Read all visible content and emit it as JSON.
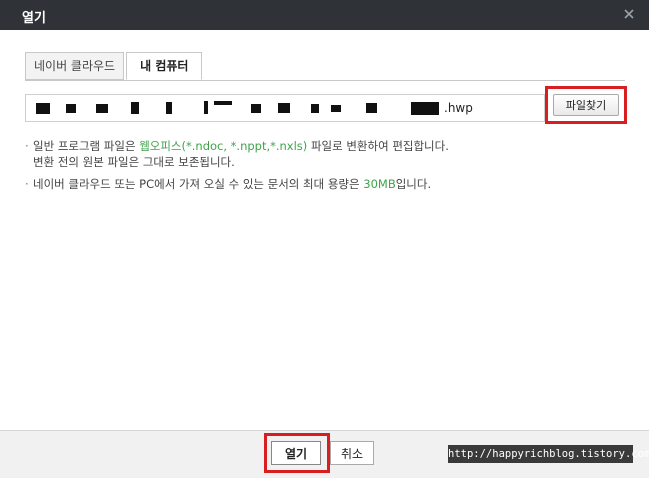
{
  "dialog": {
    "title": "열기",
    "close_icon": "close-icon"
  },
  "tabs": [
    {
      "label": "네이버 클라우드",
      "active": false
    },
    {
      "label": "내 컴퓨터",
      "active": true
    }
  ],
  "file": {
    "extension": ".hwp",
    "find_button_label": "파일찾기"
  },
  "info": {
    "line1_prefix": "일반 프로그램 파일은 ",
    "line1_highlight": "웹오피스(*.ndoc, *.nppt,*.nxls)",
    "line1_suffix": " 파일로 변환하여 편집합니다.",
    "line2": "변환 전의 원본 파일은 그대로 보존됩니다.",
    "line3_prefix": "네이버 클라우드 또는 PC에서 가져 오실 수 있는 문서의 최대 용량은 ",
    "line3_highlight": "30MB",
    "line3_suffix": "입니다."
  },
  "footer": {
    "open_label": "열기",
    "cancel_label": "취소"
  },
  "watermark": "http://happyrichblog.tistory.com",
  "colors": {
    "titlebar": "#2f3338",
    "highlight_green": "#3ea34a",
    "annotation_red": "#d81e1e"
  }
}
